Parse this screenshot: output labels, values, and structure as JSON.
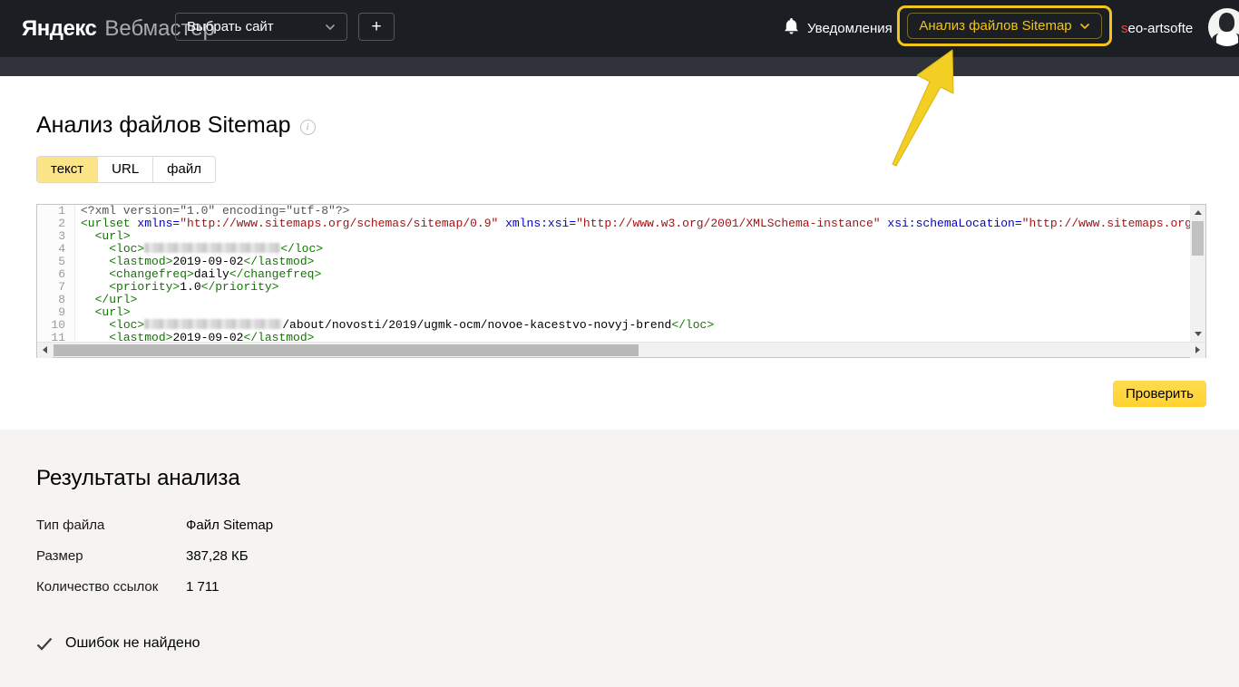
{
  "header": {
    "logo": {
      "primary": "Яндекс",
      "secondary": "Вебмастер"
    },
    "site_select": {
      "label": "Выбрать сайт"
    },
    "add_site_label": "+",
    "notifications_label": "Уведомления",
    "sitemap_dropdown_label": "Анализ файлов Sitemap",
    "username_first_letter": "s",
    "username_rest": "eo-artsofte"
  },
  "page": {
    "title": "Анализ файлов Sitemap",
    "tabs": [
      {
        "label": "текст",
        "active": true
      },
      {
        "label": "URL",
        "active": false
      },
      {
        "label": "файл",
        "active": false
      }
    ],
    "check_button_label": "Проверить"
  },
  "editor": {
    "lines": [
      {
        "n": 1,
        "tokens": [
          {
            "c": "meta",
            "s": "<?xml version=\"1.0\" encoding=\"utf-8\"?>"
          }
        ]
      },
      {
        "n": 2,
        "tokens": [
          {
            "c": "tag",
            "s": "<urlset"
          },
          {
            "c": "text",
            "s": " "
          },
          {
            "c": "attr",
            "s": "xmlns="
          },
          {
            "c": "str",
            "s": "\"http://www.sitemaps.org/schemas/sitemap/0.9\""
          },
          {
            "c": "text",
            "s": " "
          },
          {
            "c": "attr",
            "s": "xmlns:xsi="
          },
          {
            "c": "str",
            "s": "\"http://www.w3.org/2001/XMLSchema-instance\""
          },
          {
            "c": "text",
            "s": " "
          },
          {
            "c": "attr",
            "s": "xsi:schemaLocation="
          },
          {
            "c": "str",
            "s": "\"http://www.sitemaps.org"
          }
        ]
      },
      {
        "n": 3,
        "tokens": [
          {
            "c": "text",
            "s": "  "
          },
          {
            "c": "tag",
            "s": "<url>"
          }
        ]
      },
      {
        "n": 4,
        "tokens": [
          {
            "c": "text",
            "s": "    "
          },
          {
            "c": "tag",
            "s": "<loc>"
          },
          {
            "c": "blur",
            "w": 150
          },
          {
            "c": "tag",
            "s": "</loc>"
          }
        ]
      },
      {
        "n": 5,
        "tokens": [
          {
            "c": "text",
            "s": "    "
          },
          {
            "c": "tag",
            "s": "<lastmod>"
          },
          {
            "c": "text",
            "s": "2019-09-02"
          },
          {
            "c": "tag",
            "s": "</lastmod>"
          }
        ]
      },
      {
        "n": 6,
        "tokens": [
          {
            "c": "text",
            "s": "    "
          },
          {
            "c": "tag",
            "s": "<changefreq>"
          },
          {
            "c": "text",
            "s": "daily"
          },
          {
            "c": "tag",
            "s": "</changefreq>"
          }
        ]
      },
      {
        "n": 7,
        "tokens": [
          {
            "c": "text",
            "s": "    "
          },
          {
            "c": "tag",
            "s": "<priority>"
          },
          {
            "c": "text",
            "s": "1.0"
          },
          {
            "c": "tag",
            "s": "</priority>"
          }
        ]
      },
      {
        "n": 8,
        "tokens": [
          {
            "c": "text",
            "s": "  "
          },
          {
            "c": "tag",
            "s": "</url>"
          }
        ]
      },
      {
        "n": 9,
        "tokens": [
          {
            "c": "text",
            "s": "  "
          },
          {
            "c": "tag",
            "s": "<url>"
          }
        ]
      },
      {
        "n": 10,
        "tokens": [
          {
            "c": "text",
            "s": "    "
          },
          {
            "c": "tag",
            "s": "<loc>"
          },
          {
            "c": "blur",
            "w": 152
          },
          {
            "c": "text",
            "s": "/about/novosti/2019/ugmk-ocm/novoe-kacestvo-novyj-brend"
          },
          {
            "c": "tag",
            "s": "</loc>"
          }
        ]
      },
      {
        "n": 11,
        "tokens": [
          {
            "c": "text",
            "s": "    "
          },
          {
            "c": "tag",
            "s": "<lastmod>"
          },
          {
            "c": "text",
            "s": "2019-09-02"
          },
          {
            "c": "tag",
            "s": "</lastmod>"
          }
        ]
      }
    ]
  },
  "results": {
    "heading": "Результаты анализа",
    "rows": [
      {
        "label": "Тип файла",
        "value": "Файл Sitemap"
      },
      {
        "label": "Размер",
        "value": "387,28 КБ"
      },
      {
        "label": "Количество ссылок",
        "value": "1 711"
      }
    ],
    "status_ok": "Ошибок не найдено"
  },
  "icons": {
    "bell": "bell-icon",
    "info": "info-icon",
    "check": "checkmark-icon",
    "chevron": "chevron-down-icon",
    "arrow": "annotation-arrow"
  },
  "colors": {
    "header_bg": "#1b1e23",
    "subheader_bg": "#30333a",
    "section_bg": "#f5f4f2",
    "accent_yellow": "#ffd63e",
    "annotation_yellow": "#f2c41c",
    "active_tab_bg": "#fce488",
    "username_accent": "#ff3b30",
    "code_tag": "#117700",
    "code_attr": "#0000cc",
    "code_string": "#aa1111",
    "code_meta": "#555555"
  }
}
